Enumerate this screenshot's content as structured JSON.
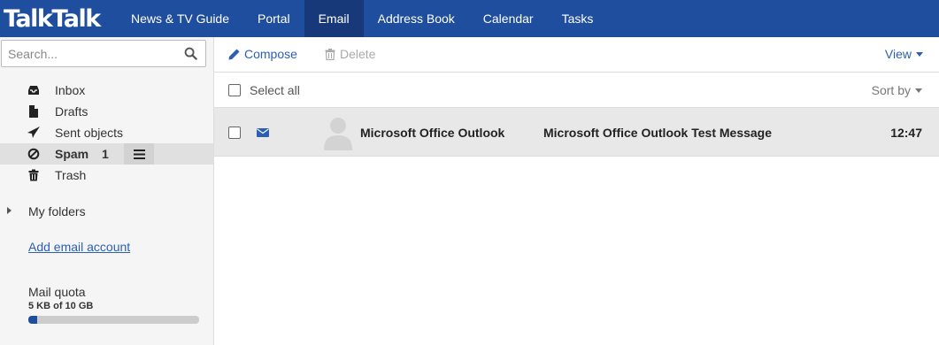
{
  "brand": {
    "logo_text": "TalkTalk"
  },
  "nav": {
    "items": [
      {
        "label": "News & TV Guide"
      },
      {
        "label": "Portal"
      },
      {
        "label": "Email",
        "active": true
      },
      {
        "label": "Address Book"
      },
      {
        "label": "Calendar"
      },
      {
        "label": "Tasks"
      }
    ]
  },
  "search": {
    "placeholder": "Search..."
  },
  "folders": [
    {
      "label": "Inbox",
      "icon": "inbox-icon"
    },
    {
      "label": "Drafts",
      "icon": "file-icon"
    },
    {
      "label": "Sent objects",
      "icon": "paper-plane-icon"
    },
    {
      "label": "Spam",
      "icon": "ban-icon",
      "count": "1",
      "active": true
    },
    {
      "label": "Trash",
      "icon": "trash-icon"
    }
  ],
  "my_folders": {
    "label": "My folders"
  },
  "add_account": {
    "label": "Add email account"
  },
  "quota": {
    "label": "Mail quota",
    "value_text": "5 KB of 10 GB",
    "fill_fraction": 0.05
  },
  "toolbar": {
    "compose_label": "Compose",
    "delete_label": "Delete",
    "view_label": "View"
  },
  "list_header": {
    "select_all_label": "Select all",
    "sort_label": "Sort by"
  },
  "messages": [
    {
      "sender": "Microsoft Office Outlook",
      "subject": "Microsoft Office Outlook Test Message",
      "time": "12:47",
      "unread": true
    }
  ],
  "colors": {
    "brand": "#1f4e9f",
    "brand_active": "#17397a",
    "link": "#2c5fb4"
  }
}
